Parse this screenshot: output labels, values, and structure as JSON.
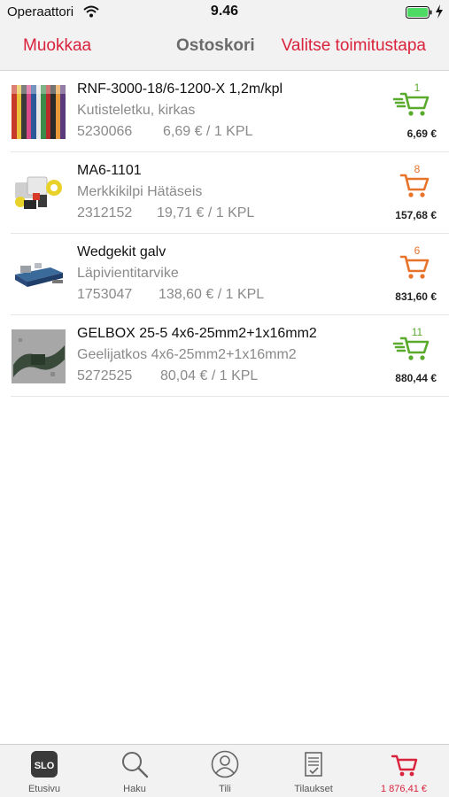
{
  "status": {
    "carrier": "Operaattori",
    "time": "9.46"
  },
  "nav": {
    "edit_label": "Muokkaa",
    "title": "Ostoskori",
    "delivery_label": "Valitse toimitustapa",
    "accent_color": "#d9223c"
  },
  "items": [
    {
      "code": "RNF-3000-18/6-1200-X 1,2m/kpl",
      "description": "Kutisteletku, kirkas",
      "number": "5230066",
      "price": "6,69 € / 1 KPL",
      "quantity": "1",
      "total": "6,69 €",
      "cart_color": "#5aaa2e",
      "icon": "cart-icon"
    },
    {
      "code": "MA6-1101",
      "description": "Merkkikilpi Hätäseis",
      "number": "2312152",
      "price": "19,71 € / 1 KPL",
      "quantity": "8",
      "total": "157,68 €",
      "cart_color": "#e8732a",
      "icon": "cart-icon"
    },
    {
      "code": "Wedgekit galv",
      "description": "Läpivientitarvike",
      "number": "1753047",
      "price": "138,60 € / 1 KPL",
      "quantity": "6",
      "total": "831,60 €",
      "cart_color": "#e8732a",
      "icon": "cart-icon"
    },
    {
      "code": "GELBOX 25-5 4x6-25mm2+1x16mm2",
      "description": "Geelijatkos 4x6-25mm2+1x16mm2",
      "number": "5272525",
      "price": "80,04 € / 1 KPL",
      "quantity": "11",
      "total": "880,44 €",
      "cart_color": "#5aaa2e",
      "icon": "cart-icon"
    }
  ],
  "tabs": [
    {
      "label": "Etusivu",
      "icon": "slo-logo-icon"
    },
    {
      "label": "Haku",
      "icon": "search-icon"
    },
    {
      "label": "Tili",
      "icon": "account-icon"
    },
    {
      "label": "Tilaukset",
      "icon": "orders-icon"
    },
    {
      "label": "1 876,41 €",
      "icon": "cart-icon",
      "active": true
    }
  ]
}
